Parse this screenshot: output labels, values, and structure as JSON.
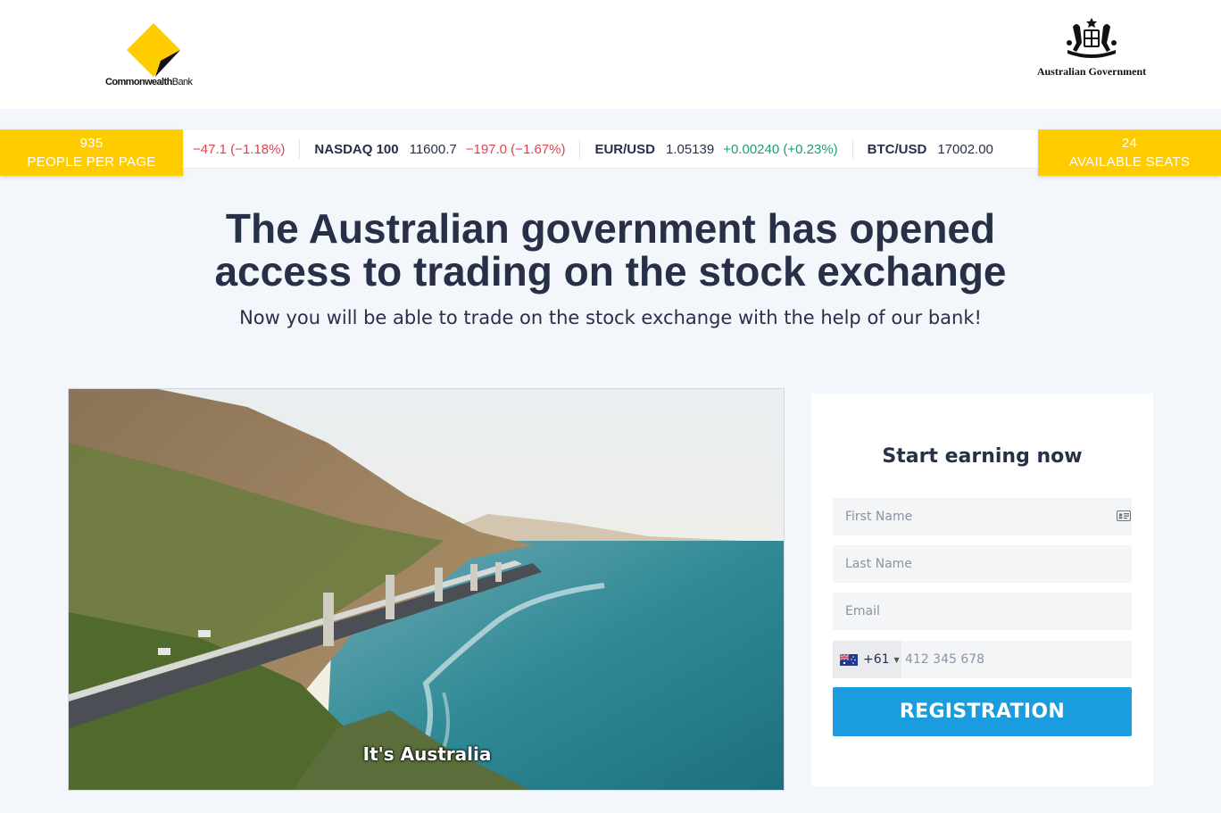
{
  "header": {
    "bank_logo": {
      "name_bold": "Commonwealth",
      "name_light": "Bank"
    },
    "gov_logo": {
      "label": "Australian Government"
    }
  },
  "stats": {
    "people_count": "935",
    "people_label": "PEOPLE PER PAGE",
    "seats_count": "24",
    "seats_label": "AVAILABLE SEATS"
  },
  "ticker": {
    "partial_change": "−47.1 (−1.18%)",
    "items": [
      {
        "symbol": "NASDAQ 100",
        "price": "11600.7",
        "change": "−197.0 (−1.67%)",
        "direction": "down"
      },
      {
        "symbol": "EUR/USD",
        "price": "1.05139",
        "change": "+0.00240 (+0.23%)",
        "direction": "up"
      },
      {
        "symbol": "BTC/USD",
        "price": "17002.00",
        "change": "",
        "direction": ""
      }
    ]
  },
  "hero": {
    "title_line1": "The Australian government has opened",
    "title_line2": "access to trading on the stock exchange",
    "subtitle": "Now you will be able to trade on the stock exchange with the help of our bank!"
  },
  "video": {
    "caption": "It's Australia"
  },
  "form": {
    "title": "Start earning now",
    "first_name_placeholder": "First Name",
    "last_name_placeholder": "Last Name",
    "email_placeholder": "Email",
    "phone_prefix": "+61",
    "phone_placeholder": "412 345 678",
    "submit_label": "REGISTRATION"
  },
  "colors": {
    "brand_yellow": "#ffcc00",
    "accent_blue": "#1a9cde",
    "negative": "#e0434f",
    "positive": "#1f9e6a"
  }
}
